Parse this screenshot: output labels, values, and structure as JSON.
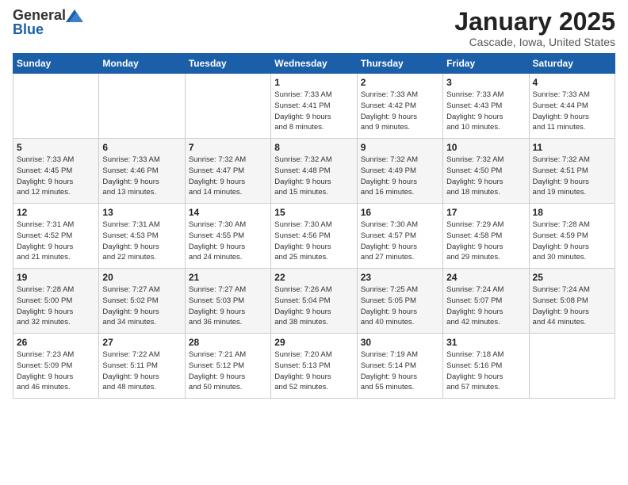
{
  "logo": {
    "general": "General",
    "blue": "Blue"
  },
  "header": {
    "month": "January 2025",
    "location": "Cascade, Iowa, United States"
  },
  "days_of_week": [
    "Sunday",
    "Monday",
    "Tuesday",
    "Wednesday",
    "Thursday",
    "Friday",
    "Saturday"
  ],
  "weeks": [
    [
      {
        "day": "",
        "info": ""
      },
      {
        "day": "",
        "info": ""
      },
      {
        "day": "",
        "info": ""
      },
      {
        "day": "1",
        "info": "Sunrise: 7:33 AM\nSunset: 4:41 PM\nDaylight: 9 hours\nand 8 minutes."
      },
      {
        "day": "2",
        "info": "Sunrise: 7:33 AM\nSunset: 4:42 PM\nDaylight: 9 hours\nand 9 minutes."
      },
      {
        "day": "3",
        "info": "Sunrise: 7:33 AM\nSunset: 4:43 PM\nDaylight: 9 hours\nand 10 minutes."
      },
      {
        "day": "4",
        "info": "Sunrise: 7:33 AM\nSunset: 4:44 PM\nDaylight: 9 hours\nand 11 minutes."
      }
    ],
    [
      {
        "day": "5",
        "info": "Sunrise: 7:33 AM\nSunset: 4:45 PM\nDaylight: 9 hours\nand 12 minutes."
      },
      {
        "day": "6",
        "info": "Sunrise: 7:33 AM\nSunset: 4:46 PM\nDaylight: 9 hours\nand 13 minutes."
      },
      {
        "day": "7",
        "info": "Sunrise: 7:32 AM\nSunset: 4:47 PM\nDaylight: 9 hours\nand 14 minutes."
      },
      {
        "day": "8",
        "info": "Sunrise: 7:32 AM\nSunset: 4:48 PM\nDaylight: 9 hours\nand 15 minutes."
      },
      {
        "day": "9",
        "info": "Sunrise: 7:32 AM\nSunset: 4:49 PM\nDaylight: 9 hours\nand 16 minutes."
      },
      {
        "day": "10",
        "info": "Sunrise: 7:32 AM\nSunset: 4:50 PM\nDaylight: 9 hours\nand 18 minutes."
      },
      {
        "day": "11",
        "info": "Sunrise: 7:32 AM\nSunset: 4:51 PM\nDaylight: 9 hours\nand 19 minutes."
      }
    ],
    [
      {
        "day": "12",
        "info": "Sunrise: 7:31 AM\nSunset: 4:52 PM\nDaylight: 9 hours\nand 21 minutes."
      },
      {
        "day": "13",
        "info": "Sunrise: 7:31 AM\nSunset: 4:53 PM\nDaylight: 9 hours\nand 22 minutes."
      },
      {
        "day": "14",
        "info": "Sunrise: 7:30 AM\nSunset: 4:55 PM\nDaylight: 9 hours\nand 24 minutes."
      },
      {
        "day": "15",
        "info": "Sunrise: 7:30 AM\nSunset: 4:56 PM\nDaylight: 9 hours\nand 25 minutes."
      },
      {
        "day": "16",
        "info": "Sunrise: 7:30 AM\nSunset: 4:57 PM\nDaylight: 9 hours\nand 27 minutes."
      },
      {
        "day": "17",
        "info": "Sunrise: 7:29 AM\nSunset: 4:58 PM\nDaylight: 9 hours\nand 29 minutes."
      },
      {
        "day": "18",
        "info": "Sunrise: 7:28 AM\nSunset: 4:59 PM\nDaylight: 9 hours\nand 30 minutes."
      }
    ],
    [
      {
        "day": "19",
        "info": "Sunrise: 7:28 AM\nSunset: 5:00 PM\nDaylight: 9 hours\nand 32 minutes."
      },
      {
        "day": "20",
        "info": "Sunrise: 7:27 AM\nSunset: 5:02 PM\nDaylight: 9 hours\nand 34 minutes."
      },
      {
        "day": "21",
        "info": "Sunrise: 7:27 AM\nSunset: 5:03 PM\nDaylight: 9 hours\nand 36 minutes."
      },
      {
        "day": "22",
        "info": "Sunrise: 7:26 AM\nSunset: 5:04 PM\nDaylight: 9 hours\nand 38 minutes."
      },
      {
        "day": "23",
        "info": "Sunrise: 7:25 AM\nSunset: 5:05 PM\nDaylight: 9 hours\nand 40 minutes."
      },
      {
        "day": "24",
        "info": "Sunrise: 7:24 AM\nSunset: 5:07 PM\nDaylight: 9 hours\nand 42 minutes."
      },
      {
        "day": "25",
        "info": "Sunrise: 7:24 AM\nSunset: 5:08 PM\nDaylight: 9 hours\nand 44 minutes."
      }
    ],
    [
      {
        "day": "26",
        "info": "Sunrise: 7:23 AM\nSunset: 5:09 PM\nDaylight: 9 hours\nand 46 minutes."
      },
      {
        "day": "27",
        "info": "Sunrise: 7:22 AM\nSunset: 5:11 PM\nDaylight: 9 hours\nand 48 minutes."
      },
      {
        "day": "28",
        "info": "Sunrise: 7:21 AM\nSunset: 5:12 PM\nDaylight: 9 hours\nand 50 minutes."
      },
      {
        "day": "29",
        "info": "Sunrise: 7:20 AM\nSunset: 5:13 PM\nDaylight: 9 hours\nand 52 minutes."
      },
      {
        "day": "30",
        "info": "Sunrise: 7:19 AM\nSunset: 5:14 PM\nDaylight: 9 hours\nand 55 minutes."
      },
      {
        "day": "31",
        "info": "Sunrise: 7:18 AM\nSunset: 5:16 PM\nDaylight: 9 hours\nand 57 minutes."
      },
      {
        "day": "",
        "info": ""
      }
    ]
  ]
}
